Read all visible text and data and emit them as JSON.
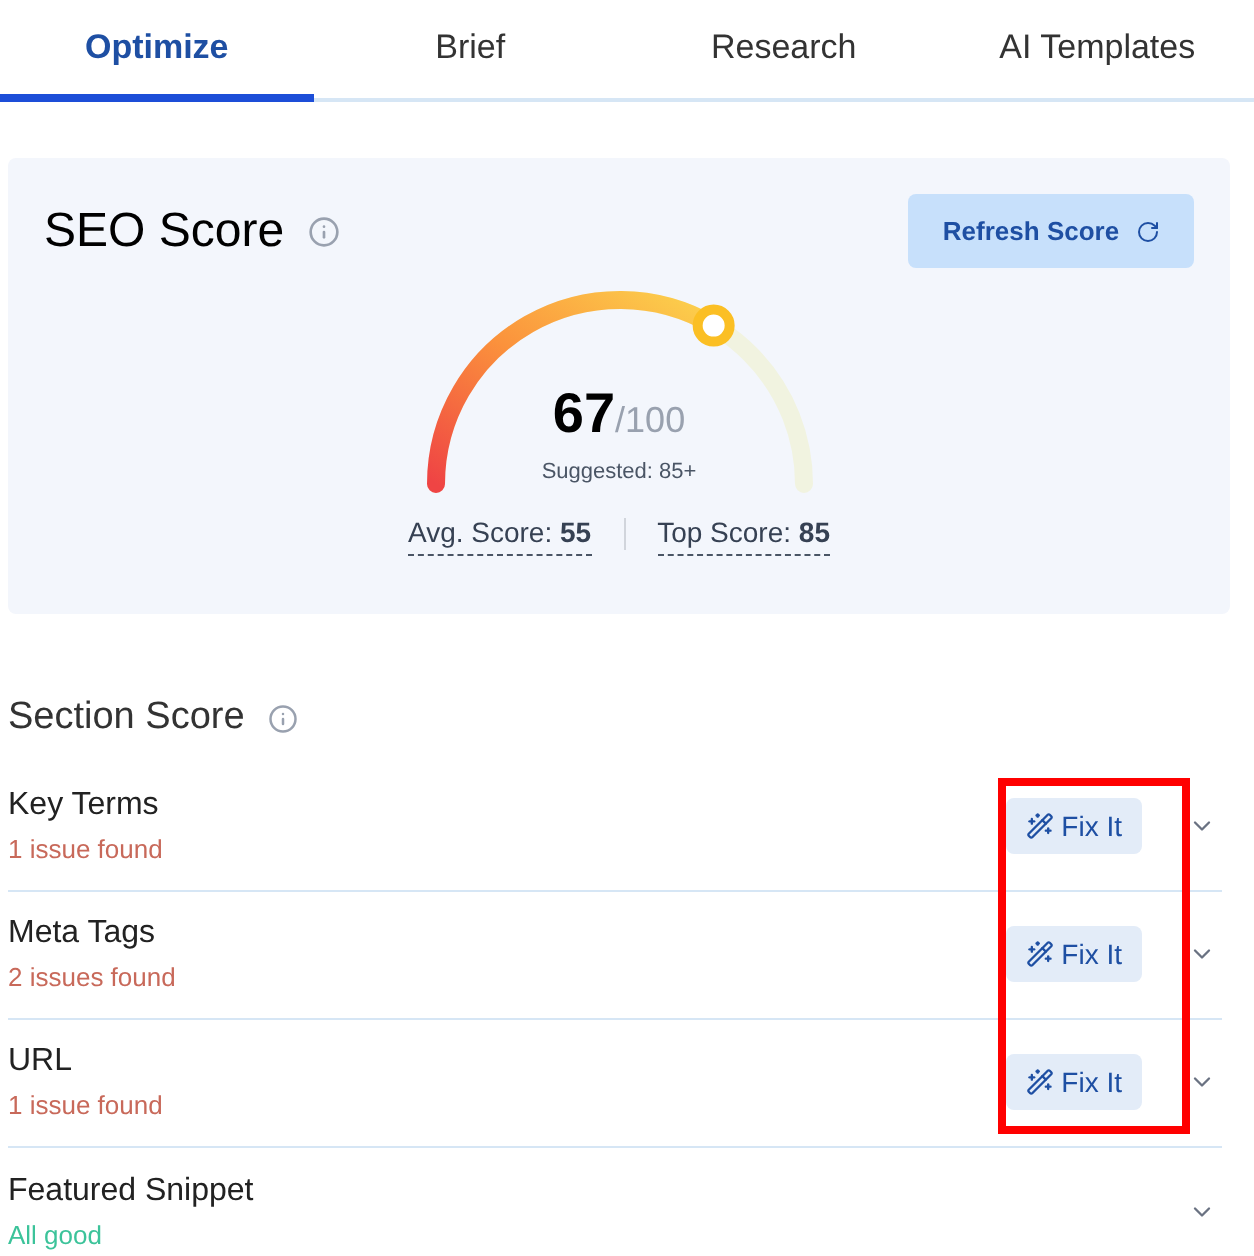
{
  "tabs": [
    {
      "label": "Optimize",
      "selected": true
    },
    {
      "label": "Brief",
      "selected": false
    },
    {
      "label": "Research",
      "selected": false
    },
    {
      "label": "AI Templates",
      "selected": false
    }
  ],
  "seo_score": {
    "title": "SEO Score",
    "refresh_button": "Refresh Score",
    "score": "67",
    "max": "/100",
    "suggested": "Suggested: 85+",
    "avg_label": "Avg. Score:",
    "avg_value": "55",
    "top_label": "Top Score:",
    "top_value": "85"
  },
  "section_score": {
    "title": "Section Score",
    "fix_highlight": true,
    "rows": [
      {
        "name": "Key Terms",
        "status_text": "1 issue found",
        "kind": "issue",
        "fix_button": "Fix It",
        "expanded": false
      },
      {
        "name": "Meta Tags",
        "status_text": "2 issues found",
        "kind": "issue",
        "fix_button": "Fix It",
        "expanded": false
      },
      {
        "name": "URL",
        "status_text": "1 issue found",
        "kind": "issue",
        "fix_button": "Fix It",
        "expanded": false
      },
      {
        "name": "Featured Snippet",
        "status_text": "All good",
        "kind": "ok",
        "expanded": false
      }
    ]
  }
}
